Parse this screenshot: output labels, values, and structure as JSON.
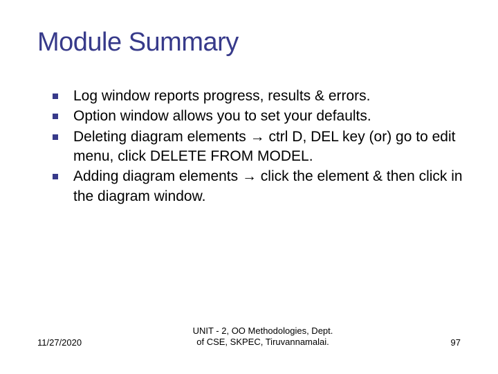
{
  "title": "Module Summary",
  "bullets": {
    "b0": "Log window reports progress, results & errors.",
    "b1": "Option window allows you to set your defaults.",
    "b2": "Deleting diagram elements → ctrl D, DEL key (or) go to edit menu, click DELETE FROM MODEL.",
    "b3": "Adding diagram elements → click the element & then click in the diagram window."
  },
  "footer": {
    "date": "11/27/2020",
    "center_line1": "UNIT - 2, OO Methodologies, Dept.",
    "center_line2": "of CSE, SKPEC, Tiruvannamalai.",
    "page": "97"
  }
}
